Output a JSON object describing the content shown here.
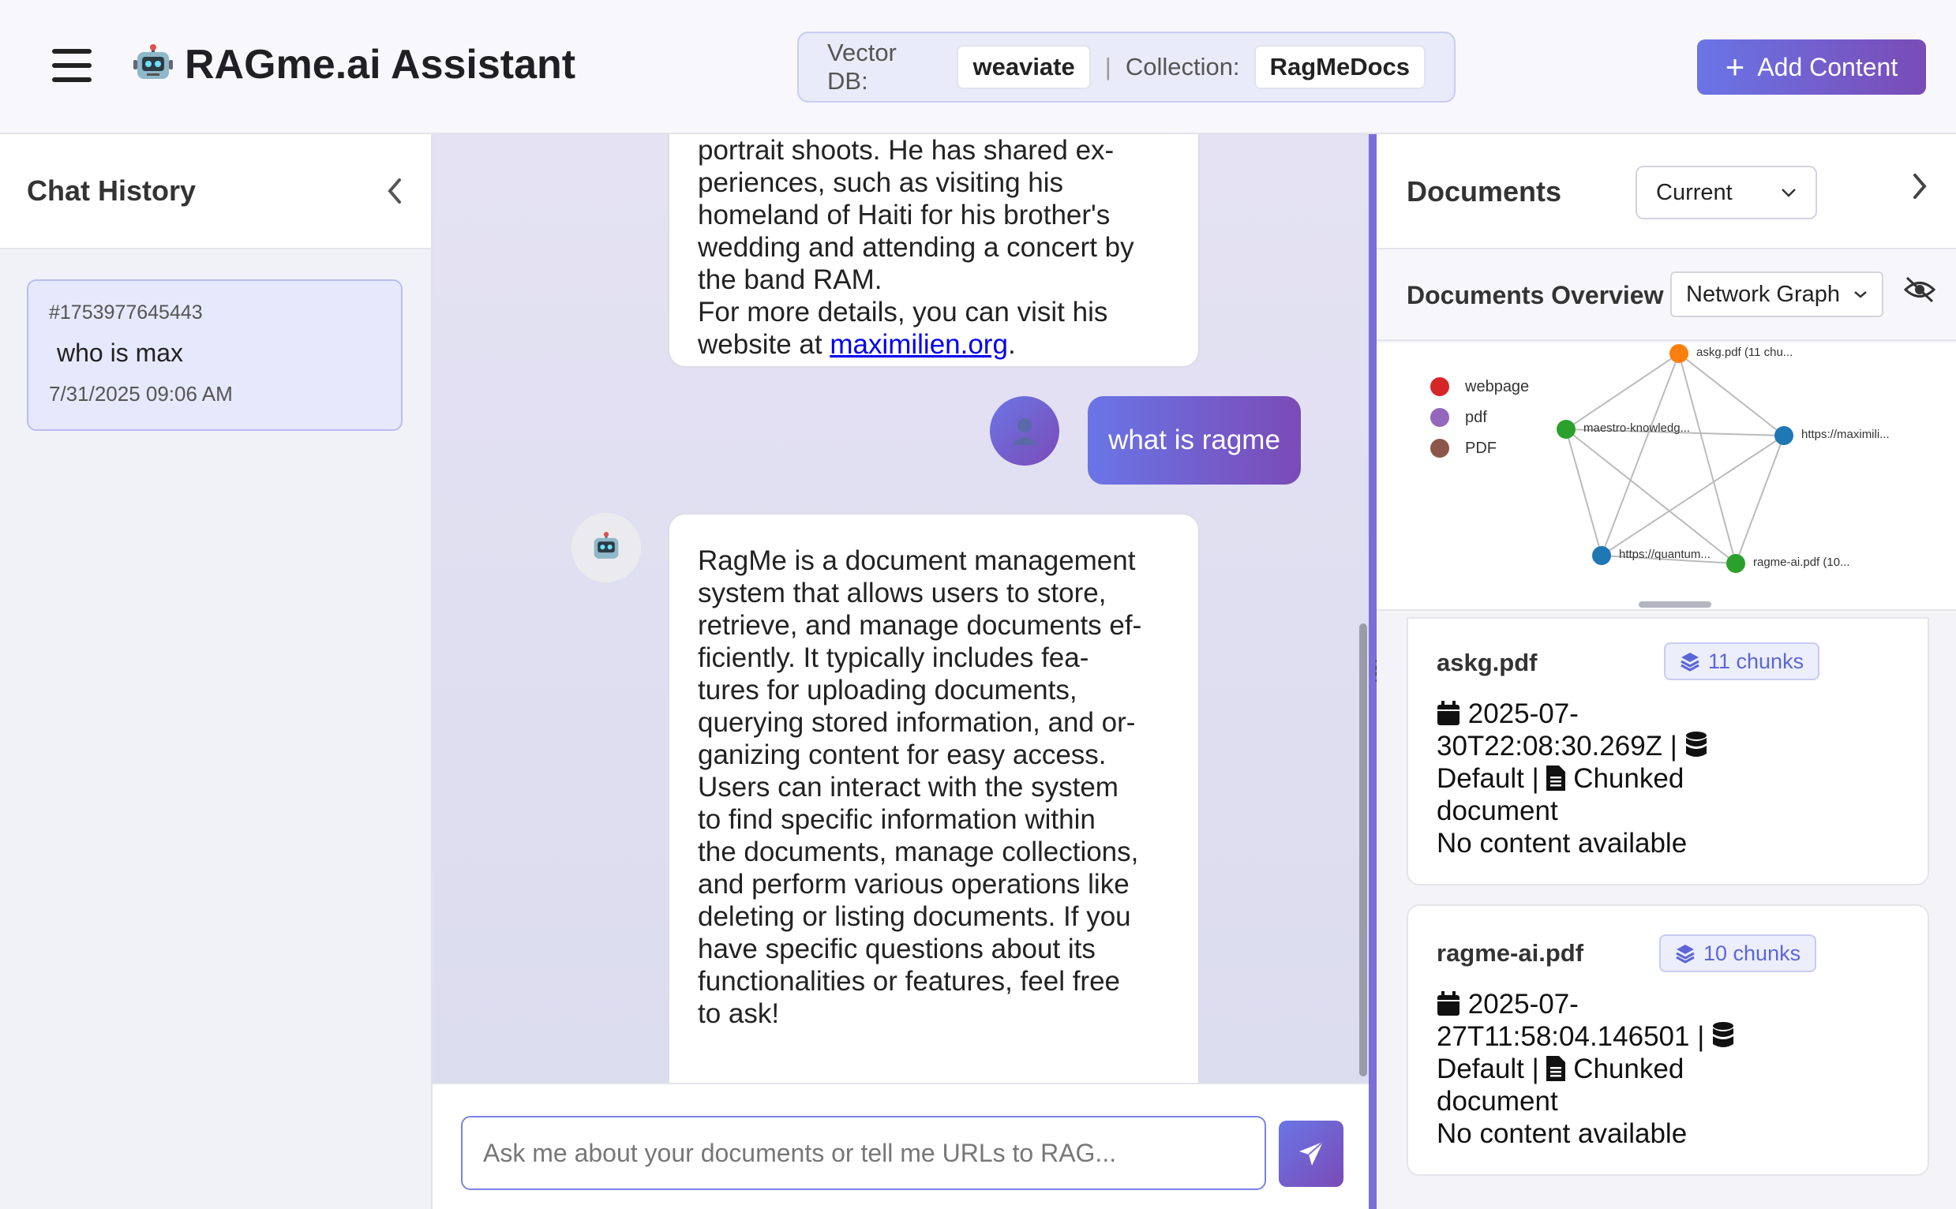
{
  "header": {
    "title": "RAGme.ai Assistant",
    "vector_db_label": "Vector DB:",
    "vector_db_value": "weaviate",
    "separator": "|",
    "collection_label": "Collection:",
    "collection_value": "RagMeDocs",
    "add_content_label": "Add Content"
  },
  "sidebar": {
    "title": "Chat History",
    "chats": [
      {
        "id": "#1753977645443",
        "title": "who is max",
        "date": "7/31/2025 09:06 AM"
      }
    ]
  },
  "chat": {
    "messages": [
      {
        "role": "assistant",
        "lines": [
          "portrait shoots. He has shared ex-",
          "periences, such as visiting his",
          "homeland of Haiti for his brother's",
          "wedding and attending a concert by",
          "the band RAM.",
          "For more details, you can visit his"
        ],
        "link_prefix": "website at ",
        "link_text": "maximilien.org",
        "link_suffix": "."
      },
      {
        "role": "user",
        "text": "what is ragme"
      },
      {
        "role": "assistant",
        "lines": [
          "RagMe is a document management",
          "system that allows users to store,",
          "retrieve, and manage documents ef-",
          "ficiently. It typically includes fea-",
          "tures for uploading documents,",
          "querying stored information, and or-",
          "ganizing content for easy access.",
          "Users can interact with the system",
          "to find specific information within",
          "the documents, manage collections,",
          "and perform various operations like",
          "deleting or listing documents. If you",
          "have specific questions about its",
          "functionalities or features, feel free",
          "to ask!"
        ]
      }
    ],
    "input_placeholder": "Ask me about your documents or tell me URLs to RAG..."
  },
  "documents": {
    "title": "Documents",
    "filter_selected": "Current",
    "overview_title": "Documents Overview",
    "overview_view": "Network Graph",
    "legend": [
      {
        "label": "webpage",
        "color": "#d62728"
      },
      {
        "label": "pdf",
        "color": "#9467bd"
      },
      {
        "label": "PDF",
        "color": "#8c564b"
      }
    ],
    "graph_nodes": [
      {
        "label": "askg.pdf (11 chu...",
        "color": "#ff7f0e"
      },
      {
        "label": "maestro-knowledg...",
        "color": "#2ca02c"
      },
      {
        "label": "https://maximili...",
        "color": "#1f77b4"
      },
      {
        "label": "https://quantum...",
        "color": "#1f77b4"
      },
      {
        "label": "ragme-ai.pdf (10...",
        "color": "#2ca02c"
      }
    ],
    "items": [
      {
        "name": "askg.pdf",
        "chunks": "11 chunks",
        "date_line1": "2025-07-",
        "date_line2": "30T22:08:30.269Z |",
        "collection": "Default |",
        "type_label": "Chunked",
        "type_label2": "document",
        "content": "No content available"
      },
      {
        "name": "ragme-ai.pdf",
        "chunks": "10 chunks",
        "date_line1": "2025-07-",
        "date_line2": "27T11:58:04.146501 |",
        "collection": "Default |",
        "type_label": "Chunked",
        "type_label2": "document",
        "content": "No content available"
      }
    ]
  }
}
